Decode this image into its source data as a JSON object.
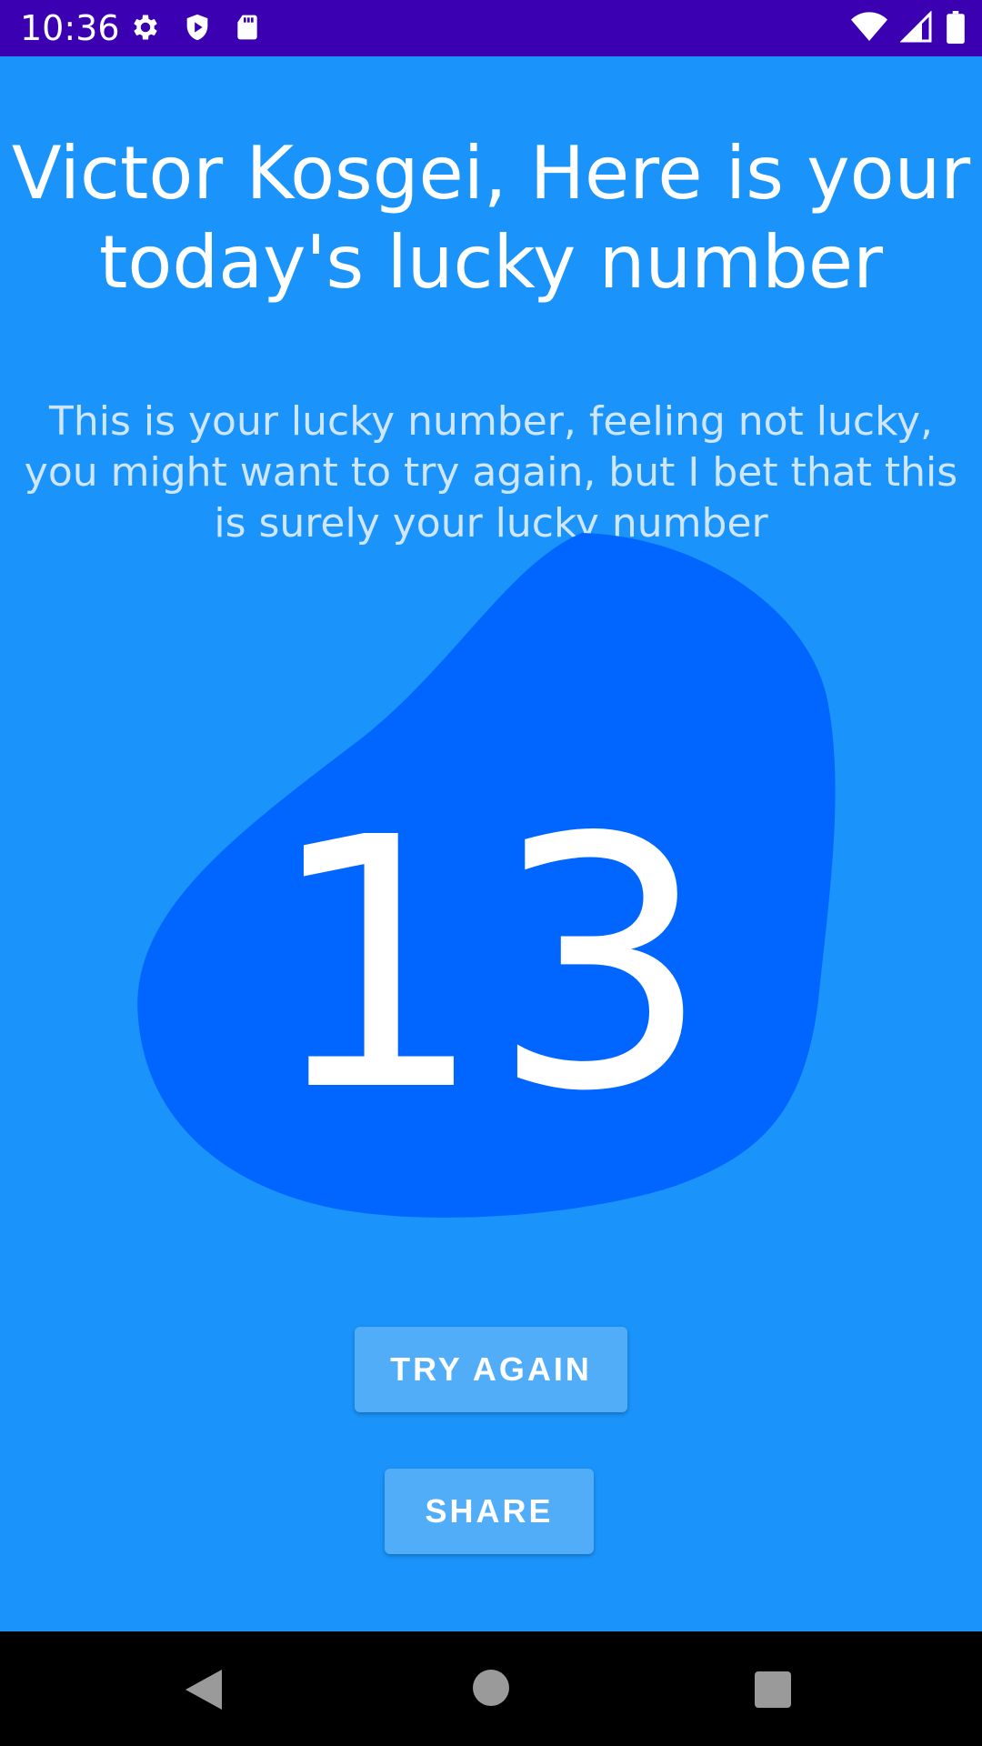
{
  "status_bar": {
    "time": "10:36",
    "left_icons": [
      "settings-icon",
      "shield-icon",
      "sd-card-icon"
    ],
    "right_icons": [
      "wifi-icon",
      "signal-icon",
      "battery-icon"
    ],
    "background_color": "#3a00b2"
  },
  "screen": {
    "title": "Victor Kosgei, Here is your today's lucky number",
    "subtitle": "This is your lucky number, feeling not lucky, you might want to try again, but I bet that this is surely your lucky number",
    "lucky_number": "13",
    "background_color": "#1a93fa",
    "blob_color": "#0066ff"
  },
  "actions": {
    "try_again_label": "TRY AGAIN",
    "share_label": "SHARE",
    "button_color": "#52adf8"
  },
  "nav_bar": {
    "icons": [
      "back-icon",
      "home-icon",
      "recents-icon"
    ]
  }
}
